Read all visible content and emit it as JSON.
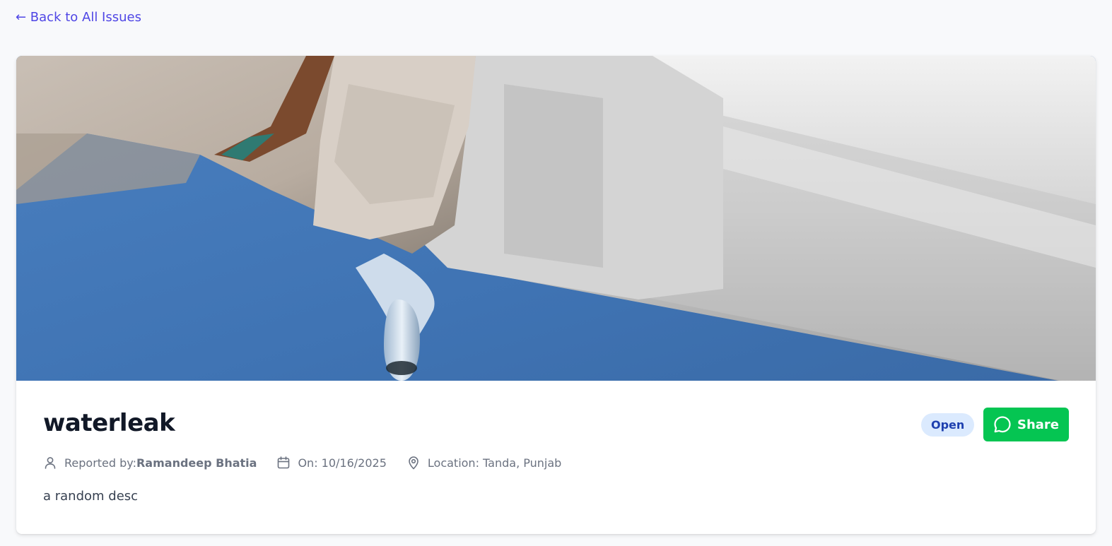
{
  "nav": {
    "back_label": "← Back to All Issues"
  },
  "issue": {
    "title": "waterleak",
    "status": "Open",
    "share_label": "Share",
    "reported_by_prefix": "Reported by:",
    "reported_by_name": "Ramandeep Bhatia",
    "date_label": "On: 10/16/2025",
    "location_label": "Location: Tanda, Punjab",
    "description": "a random desc",
    "image_icon": "leaking-pipe-photo"
  },
  "colors": {
    "link": "#4f46e5",
    "share_green": "#05c552",
    "badge_bg": "#dbeafe",
    "badge_text": "#1e40af",
    "sky_blue": "#3f73b3"
  }
}
